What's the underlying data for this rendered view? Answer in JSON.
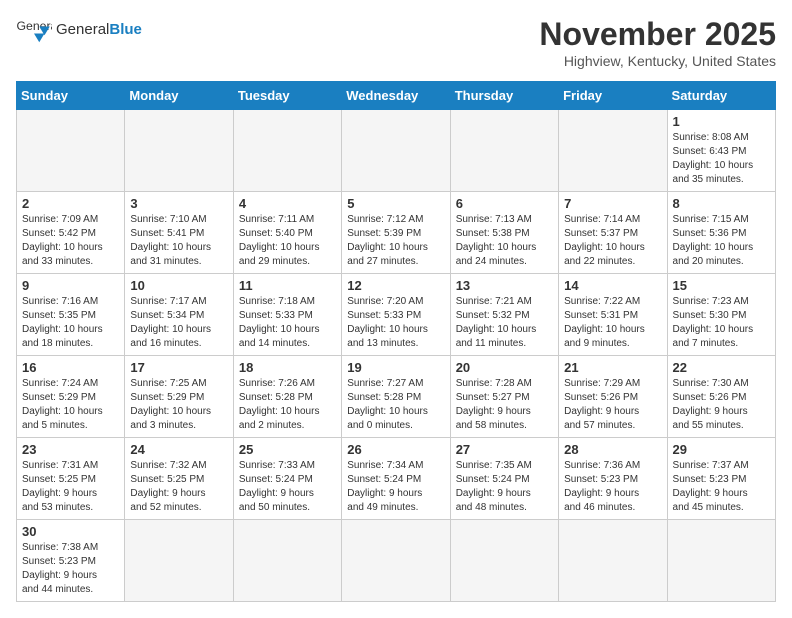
{
  "header": {
    "logo_general": "General",
    "logo_blue": "Blue",
    "month_title": "November 2025",
    "location": "Highview, Kentucky, United States"
  },
  "weekdays": [
    "Sunday",
    "Monday",
    "Tuesday",
    "Wednesday",
    "Thursday",
    "Friday",
    "Saturday"
  ],
  "weeks": [
    [
      {
        "day": "",
        "info": ""
      },
      {
        "day": "",
        "info": ""
      },
      {
        "day": "",
        "info": ""
      },
      {
        "day": "",
        "info": ""
      },
      {
        "day": "",
        "info": ""
      },
      {
        "day": "",
        "info": ""
      },
      {
        "day": "1",
        "info": "Sunrise: 8:08 AM\nSunset: 6:43 PM\nDaylight: 10 hours\nand 35 minutes."
      }
    ],
    [
      {
        "day": "2",
        "info": "Sunrise: 7:09 AM\nSunset: 5:42 PM\nDaylight: 10 hours\nand 33 minutes."
      },
      {
        "day": "3",
        "info": "Sunrise: 7:10 AM\nSunset: 5:41 PM\nDaylight: 10 hours\nand 31 minutes."
      },
      {
        "day": "4",
        "info": "Sunrise: 7:11 AM\nSunset: 5:40 PM\nDaylight: 10 hours\nand 29 minutes."
      },
      {
        "day": "5",
        "info": "Sunrise: 7:12 AM\nSunset: 5:39 PM\nDaylight: 10 hours\nand 27 minutes."
      },
      {
        "day": "6",
        "info": "Sunrise: 7:13 AM\nSunset: 5:38 PM\nDaylight: 10 hours\nand 24 minutes."
      },
      {
        "day": "7",
        "info": "Sunrise: 7:14 AM\nSunset: 5:37 PM\nDaylight: 10 hours\nand 22 minutes."
      },
      {
        "day": "8",
        "info": "Sunrise: 7:15 AM\nSunset: 5:36 PM\nDaylight: 10 hours\nand 20 minutes."
      }
    ],
    [
      {
        "day": "9",
        "info": "Sunrise: 7:16 AM\nSunset: 5:35 PM\nDaylight: 10 hours\nand 18 minutes."
      },
      {
        "day": "10",
        "info": "Sunrise: 7:17 AM\nSunset: 5:34 PM\nDaylight: 10 hours\nand 16 minutes."
      },
      {
        "day": "11",
        "info": "Sunrise: 7:18 AM\nSunset: 5:33 PM\nDaylight: 10 hours\nand 14 minutes."
      },
      {
        "day": "12",
        "info": "Sunrise: 7:20 AM\nSunset: 5:33 PM\nDaylight: 10 hours\nand 13 minutes."
      },
      {
        "day": "13",
        "info": "Sunrise: 7:21 AM\nSunset: 5:32 PM\nDaylight: 10 hours\nand 11 minutes."
      },
      {
        "day": "14",
        "info": "Sunrise: 7:22 AM\nSunset: 5:31 PM\nDaylight: 10 hours\nand 9 minutes."
      },
      {
        "day": "15",
        "info": "Sunrise: 7:23 AM\nSunset: 5:30 PM\nDaylight: 10 hours\nand 7 minutes."
      }
    ],
    [
      {
        "day": "16",
        "info": "Sunrise: 7:24 AM\nSunset: 5:29 PM\nDaylight: 10 hours\nand 5 minutes."
      },
      {
        "day": "17",
        "info": "Sunrise: 7:25 AM\nSunset: 5:29 PM\nDaylight: 10 hours\nand 3 minutes."
      },
      {
        "day": "18",
        "info": "Sunrise: 7:26 AM\nSunset: 5:28 PM\nDaylight: 10 hours\nand 2 minutes."
      },
      {
        "day": "19",
        "info": "Sunrise: 7:27 AM\nSunset: 5:28 PM\nDaylight: 10 hours\nand 0 minutes."
      },
      {
        "day": "20",
        "info": "Sunrise: 7:28 AM\nSunset: 5:27 PM\nDaylight: 9 hours\nand 58 minutes."
      },
      {
        "day": "21",
        "info": "Sunrise: 7:29 AM\nSunset: 5:26 PM\nDaylight: 9 hours\nand 57 minutes."
      },
      {
        "day": "22",
        "info": "Sunrise: 7:30 AM\nSunset: 5:26 PM\nDaylight: 9 hours\nand 55 minutes."
      }
    ],
    [
      {
        "day": "23",
        "info": "Sunrise: 7:31 AM\nSunset: 5:25 PM\nDaylight: 9 hours\nand 53 minutes."
      },
      {
        "day": "24",
        "info": "Sunrise: 7:32 AM\nSunset: 5:25 PM\nDaylight: 9 hours\nand 52 minutes."
      },
      {
        "day": "25",
        "info": "Sunrise: 7:33 AM\nSunset: 5:24 PM\nDaylight: 9 hours\nand 50 minutes."
      },
      {
        "day": "26",
        "info": "Sunrise: 7:34 AM\nSunset: 5:24 PM\nDaylight: 9 hours\nand 49 minutes."
      },
      {
        "day": "27",
        "info": "Sunrise: 7:35 AM\nSunset: 5:24 PM\nDaylight: 9 hours\nand 48 minutes."
      },
      {
        "day": "28",
        "info": "Sunrise: 7:36 AM\nSunset: 5:23 PM\nDaylight: 9 hours\nand 46 minutes."
      },
      {
        "day": "29",
        "info": "Sunrise: 7:37 AM\nSunset: 5:23 PM\nDaylight: 9 hours\nand 45 minutes."
      }
    ],
    [
      {
        "day": "30",
        "info": "Sunrise: 7:38 AM\nSunset: 5:23 PM\nDaylight: 9 hours\nand 44 minutes."
      },
      {
        "day": "",
        "info": ""
      },
      {
        "day": "",
        "info": ""
      },
      {
        "day": "",
        "info": ""
      },
      {
        "day": "",
        "info": ""
      },
      {
        "day": "",
        "info": ""
      },
      {
        "day": "",
        "info": ""
      }
    ]
  ]
}
